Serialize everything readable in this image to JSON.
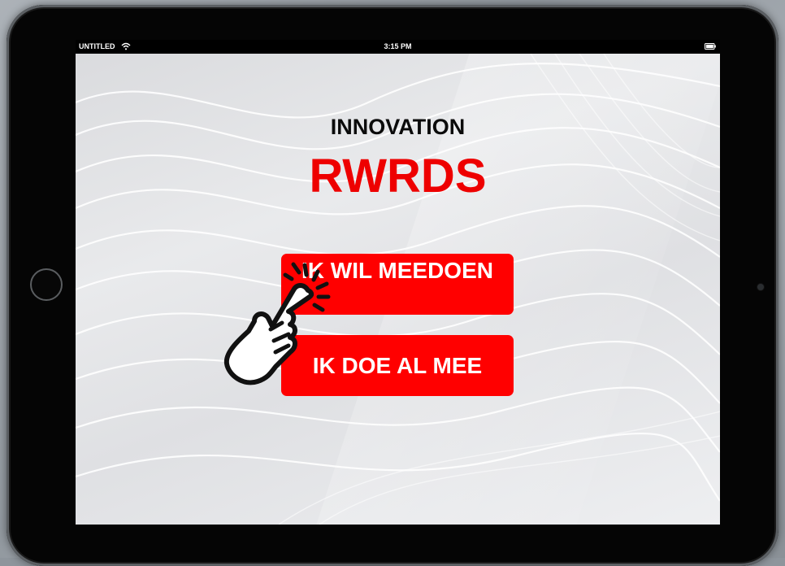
{
  "status_bar": {
    "carrier": "UNTITLED",
    "time": "3:15 PM",
    "wifi_icon": "wifi-icon",
    "battery_icon": "battery-icon"
  },
  "title": {
    "line1": "INNOVATION",
    "line2": "RWRDS",
    "line2_color": "#ee0000"
  },
  "buttons": {
    "join_label": "IK WIL MEEDOEN",
    "member_label": "IK DOE AL MEE",
    "color": "#ff0000"
  },
  "icons": {
    "pointer": "tap-hand-icon"
  }
}
